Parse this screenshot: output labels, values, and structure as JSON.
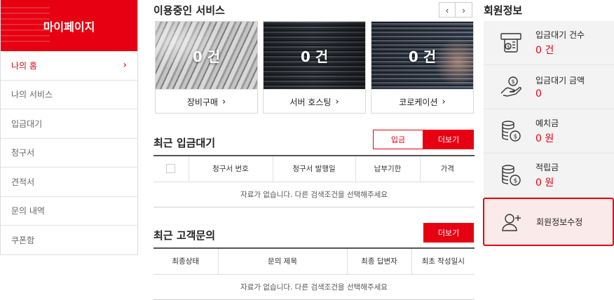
{
  "sidebar": {
    "title": "마이페이지",
    "items": [
      {
        "label": "나의 홈",
        "active": true
      },
      {
        "label": "나의 서비스"
      },
      {
        "label": "입금대기"
      },
      {
        "label": "청구서"
      },
      {
        "label": "견적서"
      },
      {
        "label": "문의 내역"
      },
      {
        "label": "쿠폰함"
      }
    ],
    "active_chevron": "›"
  },
  "services": {
    "title": "이용중인 서비스",
    "prev": "‹",
    "next": "›",
    "cards": [
      {
        "count": "0 건",
        "label": "장비구매",
        "image": "network-cables"
      },
      {
        "count": "0 건",
        "label": "서버 호스팅",
        "image": "server-room"
      },
      {
        "count": "0 건",
        "label": "코로케이션",
        "image": "server-rack"
      }
    ],
    "arrow": "›"
  },
  "payments": {
    "title": "최근 입금대기",
    "tab_label": "입금",
    "more_label": "더보기",
    "columns": [
      "",
      "청구서 번호",
      "청구서 발행일",
      "납부기한",
      "가격"
    ],
    "empty": "자료가 없습니다. 다른 검색조건을 선택해주세요"
  },
  "inquiries": {
    "title": "최근 고객문의",
    "more_label": "더보기",
    "columns": [
      "최종상태",
      "문의 제목",
      "최종 답변자",
      "최초 작성일시"
    ],
    "empty": "자료가 없습니다. 다른 검색조건을 선택해주세요"
  },
  "member": {
    "title": "회원정보",
    "items": [
      {
        "label": "입금대기 건수",
        "value": "0 건",
        "icon": "atm-icon"
      },
      {
        "label": "입금대기 금액",
        "value": "0",
        "icon": "hand-coin-icon"
      },
      {
        "label": "예치금",
        "value": "0 원",
        "icon": "coin-stack-icon"
      },
      {
        "label": "적립금",
        "value": "0 원",
        "icon": "coin-stack-icon"
      }
    ],
    "edit_label": "회원정보수정",
    "edit_icon": "user-add-icon"
  },
  "colors": {
    "accent": "#e60012",
    "panel_bg": "#f3f3f3",
    "highlight_bg": "#fbeaea"
  }
}
